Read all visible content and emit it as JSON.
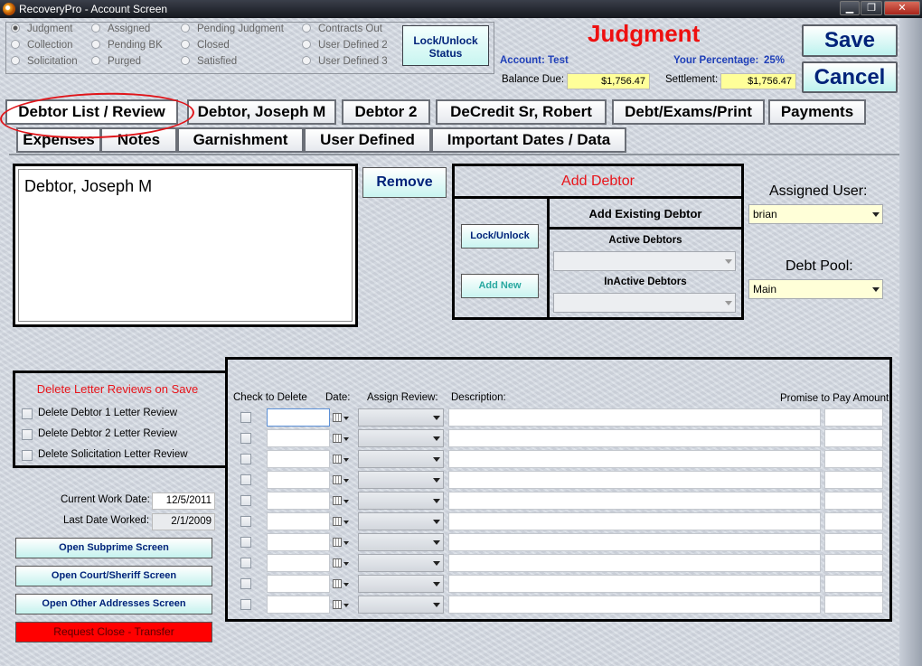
{
  "window": {
    "title": "RecoveryPro - Account Screen",
    "controls": [
      "▁",
      "❐",
      "✕"
    ]
  },
  "status": {
    "options": [
      {
        "label": "Judgment",
        "checked": true
      },
      {
        "label": "Collection",
        "checked": false
      },
      {
        "label": "Solicitation",
        "checked": false
      },
      {
        "label": "Assigned",
        "checked": false
      },
      {
        "label": "Pending BK",
        "checked": false
      },
      {
        "label": "Purged",
        "checked": false
      },
      {
        "label": "Pending Judgment",
        "checked": false
      },
      {
        "label": "Closed",
        "checked": false
      },
      {
        "label": "Satisfied",
        "checked": false
      },
      {
        "label": "Contracts Out",
        "checked": false
      },
      {
        "label": "User Defined 2",
        "checked": false
      },
      {
        "label": "User Defined 3",
        "checked": false
      }
    ],
    "lock_unlock_label": "Lock/Unlock Status"
  },
  "header": {
    "status_title": "Judgment",
    "account_label": "Account:",
    "account_value": "Test",
    "percentage_label": "Your Percentage:",
    "percentage_value": "25%",
    "balance_label": "Balance Due:",
    "balance_value": "$1,756.47",
    "settlement_label": "Settlement:",
    "settlement_value": "$1,756.47",
    "save_label": "Save",
    "cancel_label": "Cancel"
  },
  "tabs": {
    "row1": [
      "Debtor List / Review",
      "Debtor, Joseph M",
      "Debtor 2",
      "DeCredit Sr, Robert",
      "Debt/Exams/Print",
      "Payments"
    ],
    "row2": [
      "Expenses",
      "Notes",
      "Garnishment",
      "User Defined",
      "Important Dates / Data"
    ],
    "active": "Debtor List / Review"
  },
  "debtors": {
    "list": [
      "Debtor, Joseph M"
    ],
    "remove_label": "Remove",
    "add_debtor_label": "Add Debtor",
    "add_existing_label": "Add Existing Debtor",
    "lock_unlock_label": "Lock/Unlock",
    "add_new_label": "Add New",
    "active_label": "Active Debtors",
    "inactive_label": "InActive Debtors",
    "assigned_user_label": "Assigned User:",
    "assigned_user_value": "brian",
    "debt_pool_label": "Debt Pool:",
    "debt_pool_value": "Main"
  },
  "delete_reviews": {
    "title": "Delete Letter Reviews on Save",
    "items": [
      "Delete Debtor 1 Letter Review",
      "Delete Debtor 2 Letter Review",
      "Delete Solicitation Letter Review"
    ]
  },
  "work": {
    "current_label": "Current Work Date:",
    "current_value": "12/5/2011",
    "last_label": "Last Date Worked:",
    "last_value": "2/1/2009"
  },
  "side_buttons": {
    "subprime": "Open Subprime Screen",
    "court": "Open Court/Sheriff Screen",
    "addresses": "Open Other Addresses Screen",
    "request_close": "Request Close - Transfer"
  },
  "reviews": {
    "headers": {
      "check": "Check to Delete",
      "date": "Date:",
      "assign": "Assign Review:",
      "description": "Description:",
      "promise": "Promise to Pay Amount:"
    },
    "row_count": 10
  },
  "colors": {
    "accent_red": "#ee1010",
    "navy": "#00237a",
    "highlight_yellow": "#ffff99",
    "request_close_bg": "#ff0000"
  }
}
